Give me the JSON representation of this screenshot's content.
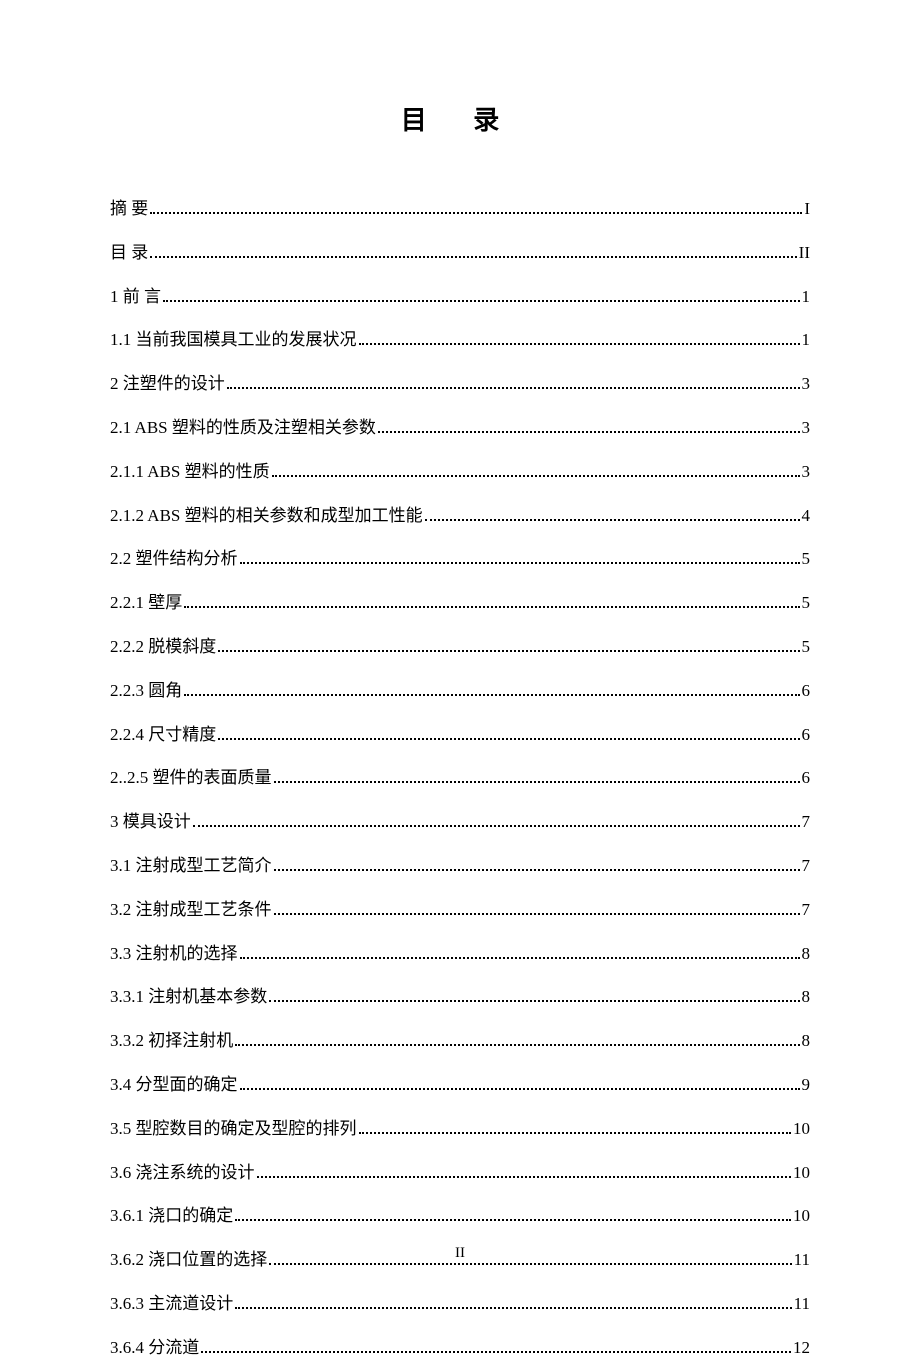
{
  "title": "目 录",
  "page_number_footer": "II",
  "toc": [
    {
      "label": "摘    要",
      "page": "I"
    },
    {
      "label": "目    录",
      "page": "II"
    },
    {
      "label": "1  前  言",
      "page": "1"
    },
    {
      "label": "1.1  当前我国模具工业的发展状况",
      "page": "1"
    },
    {
      "label": "2  注塑件的设计",
      "page": "3"
    },
    {
      "label": "2.1 ABS 塑料的性质及注塑相关参数",
      "page": "3"
    },
    {
      "label": "2.1.1 ABS 塑料的性质",
      "page": "3"
    },
    {
      "label": "2.1.2 ABS 塑料的相关参数和成型加工性能",
      "page": "4"
    },
    {
      "label": "2.2  塑件结构分析",
      "page": "5"
    },
    {
      "label": "2.2.1  壁厚",
      "page": "5"
    },
    {
      "label": "2.2.2  脱模斜度",
      "page": "5"
    },
    {
      "label": "2.2.3  圆角",
      "page": "6"
    },
    {
      "label": "2.2.4 尺寸精度",
      "page": "6"
    },
    {
      "label": "2..2.5  塑件的表面质量",
      "page": "6"
    },
    {
      "label": "3    模具设计",
      "page": "7"
    },
    {
      "label": "3.1  注射成型工艺简介",
      "page": "7"
    },
    {
      "label": "3.2  注射成型工艺条件",
      "page": "7"
    },
    {
      "label": "3.3  注射机的选择",
      "page": "8"
    },
    {
      "label": "3.3.1  注射机基本参数",
      "page": "8"
    },
    {
      "label": "3.3.2  初择注射机",
      "page": "8"
    },
    {
      "label": "3.4  分型面的确定",
      "page": "9"
    },
    {
      "label": "3.5  型腔数目的确定及型腔的排列",
      "page": "10"
    },
    {
      "label": "3.6  浇注系统的设计",
      "page": "10"
    },
    {
      "label": "3.6.1  浇口的确定",
      "page": "10"
    },
    {
      "label": "3.6.2  浇口位置的选择",
      "page": "11"
    },
    {
      "label": "3.6.3  主流道设计",
      "page": "11"
    },
    {
      "label": "3.6.4  分流道",
      "page": "12"
    }
  ]
}
